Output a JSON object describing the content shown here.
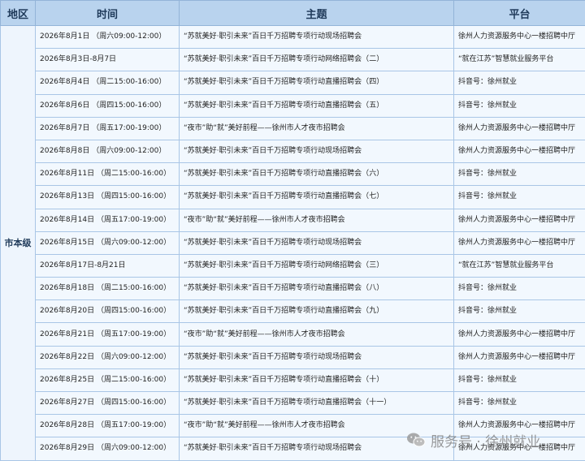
{
  "headers": {
    "region": "地区",
    "time": "时间",
    "topic": "主题",
    "platform": "平台"
  },
  "region": "市本级",
  "rows": [
    {
      "time": "2026年8月1日  （周六09:00-12:00）",
      "topic": "“苏就美好·职引未来”百日千万招聘专项行动现场招聘会",
      "platform": "徐州人力资源服务中心一楼招聘中厅"
    },
    {
      "time": "2026年8月3日-8月7日",
      "topic": "“苏就美好·职引未来”百日千万招聘专项行动网络招聘会（二）",
      "platform": "“就在江苏”智慧就业服务平台"
    },
    {
      "time": "2026年8月4日  （周二15:00-16:00）",
      "topic": "“苏就美好·职引未来”百日千万招聘专项行动直播招聘会（四）",
      "platform": "抖音号：徐州就业"
    },
    {
      "time": "2026年8月6日  （周四15:00-16:00）",
      "topic": "“苏就美好·职引未来”百日千万招聘专项行动直播招聘会（五）",
      "platform": "抖音号：徐州就业"
    },
    {
      "time": "2026年8月7日  （周五17:00-19:00）",
      "topic": "“夜市”助“就”美好前程——徐州市人才夜市招聘会",
      "platform": "徐州人力资源服务中心一楼招聘中厅"
    },
    {
      "time": "2026年8月8日  （周六09:00-12:00）",
      "topic": "“苏就美好·职引未来”百日千万招聘专项行动现场招聘会",
      "platform": "徐州人力资源服务中心一楼招聘中厅"
    },
    {
      "time": "2026年8月11日  （周二15:00-16:00）",
      "topic": "“苏就美好·职引未来”百日千万招聘专项行动直播招聘会（六）",
      "platform": "抖音号：徐州就业"
    },
    {
      "time": "2026年8月13日  （周四15:00-16:00）",
      "topic": "“苏就美好·职引未来”百日千万招聘专项行动直播招聘会（七）",
      "platform": "抖音号：徐州就业"
    },
    {
      "time": "2026年8月14日  （周五17:00-19:00）",
      "topic": "“夜市”助“就”美好前程——徐州市人才夜市招聘会",
      "platform": "徐州人力资源服务中心一楼招聘中厅"
    },
    {
      "time": "2026年8月15日  （周六09:00-12:00）",
      "topic": "“苏就美好·职引未来”百日千万招聘专项行动现场招聘会",
      "platform": "徐州人力资源服务中心一楼招聘中厅"
    },
    {
      "time": "2026年8月17日-8月21日",
      "topic": "“苏就美好·职引未来”百日千万招聘专项行动网络招聘会（三）",
      "platform": "“就在江苏”智慧就业服务平台"
    },
    {
      "time": "2026年8月18日  （周二15:00-16:00）",
      "topic": "“苏就美好·职引未来”百日千万招聘专项行动直播招聘会（八）",
      "platform": "抖音号：徐州就业"
    },
    {
      "time": "2026年8月20日  （周四15:00-16:00）",
      "topic": "“苏就美好·职引未来”百日千万招聘专项行动直播招聘会（九）",
      "platform": "抖音号：徐州就业"
    },
    {
      "time": "2026年8月21日  （周五17:00-19:00）",
      "topic": "“夜市”助“就”美好前程——徐州市人才夜市招聘会",
      "platform": "徐州人力资源服务中心一楼招聘中厅"
    },
    {
      "time": "2026年8月22日  （周六09:00-12:00）",
      "topic": "“苏就美好·职引未来”百日千万招聘专项行动现场招聘会",
      "platform": "徐州人力资源服务中心一楼招聘中厅"
    },
    {
      "time": "2026年8月25日  （周二15:00-16:00）",
      "topic": "“苏就美好·职引未来”百日千万招聘专项行动直播招聘会（十）",
      "platform": "抖音号：徐州就业"
    },
    {
      "time": "2026年8月27日  （周四15:00-16:00）",
      "topic": "“苏就美好·职引未来”百日千万招聘专项行动直播招聘会（十一）",
      "platform": "抖音号：徐州就业"
    },
    {
      "time": "2026年8月28日  （周五17:00-19:00）",
      "topic": "“夜市”助“就”美好前程——徐州市人才夜市招聘会",
      "platform": "徐州人力资源服务中心一楼招聘中厅"
    },
    {
      "time": "2026年8月29日  （周六09:00-12:00）",
      "topic": "“苏就美好·职引未来”百日千万招聘专项行动现场招聘会",
      "platform": "徐州人力资源服务中心一楼招聘中厅"
    }
  ],
  "watermark": {
    "text": "服务号 · 徐州就业",
    "icon": "wechat-icon"
  }
}
